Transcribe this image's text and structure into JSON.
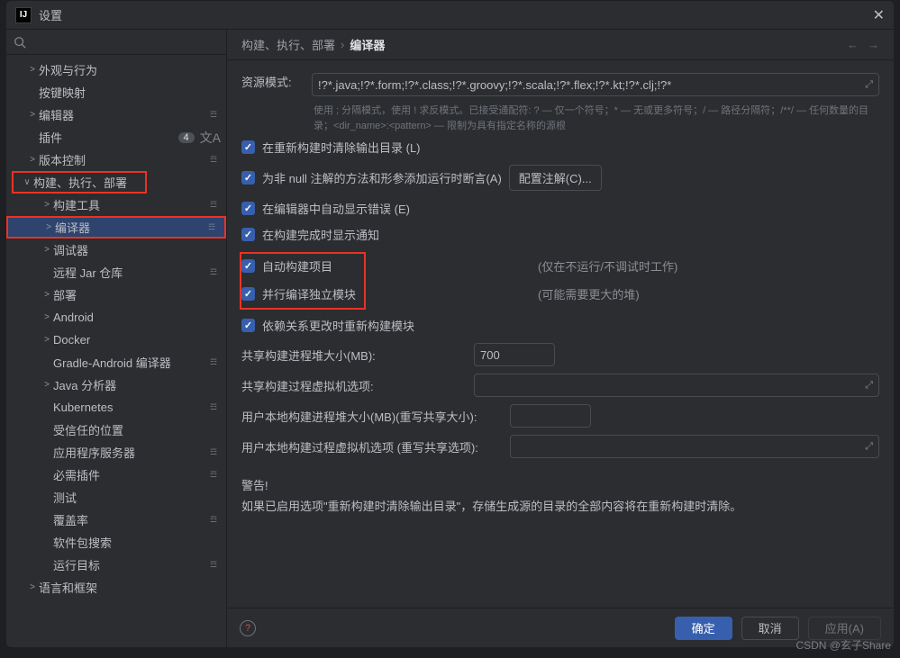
{
  "title": "设置",
  "search": {
    "placeholder": ""
  },
  "sidebar": {
    "items": [
      {
        "label": "外观与行为",
        "chev": ">",
        "d": 0
      },
      {
        "label": "按键映射",
        "chev": "",
        "d": 0
      },
      {
        "label": "编辑器",
        "chev": ">",
        "d": 0,
        "tag": "☲"
      },
      {
        "label": "插件",
        "chev": "",
        "d": 0,
        "badge": "4",
        "lang": "文A"
      },
      {
        "label": "版本控制",
        "chev": ">",
        "d": 0,
        "tag": "☲"
      },
      {
        "label": "构建、执行、部署",
        "chev": "∨",
        "d": 0,
        "hl": true
      },
      {
        "label": "构建工具",
        "chev": ">",
        "d": 1,
        "tag": "☲"
      },
      {
        "label": "编译器",
        "chev": ">",
        "d": 1,
        "tag": "☲",
        "sel": true,
        "hl": true,
        "hlfull": true
      },
      {
        "label": "调试器",
        "chev": ">",
        "d": 1
      },
      {
        "label": "远程 Jar 仓库",
        "chev": "",
        "d": 1,
        "tag": "☲"
      },
      {
        "label": "部署",
        "chev": ">",
        "d": 1
      },
      {
        "label": "Android",
        "chev": ">",
        "d": 1
      },
      {
        "label": "Docker",
        "chev": ">",
        "d": 1
      },
      {
        "label": "Gradle-Android 编译器",
        "chev": "",
        "d": 1,
        "tag": "☲"
      },
      {
        "label": "Java 分析器",
        "chev": ">",
        "d": 1
      },
      {
        "label": "Kubernetes",
        "chev": "",
        "d": 1,
        "tag": "☲"
      },
      {
        "label": "受信任的位置",
        "chev": "",
        "d": 1
      },
      {
        "label": "应用程序服务器",
        "chev": "",
        "d": 1,
        "tag": "☲"
      },
      {
        "label": "必需插件",
        "chev": "",
        "d": 1,
        "tag": "☲"
      },
      {
        "label": "测试",
        "chev": "",
        "d": 1
      },
      {
        "label": "覆盖率",
        "chev": "",
        "d": 1,
        "tag": "☲"
      },
      {
        "label": "软件包搜索",
        "chev": "",
        "d": 1
      },
      {
        "label": "运行目标",
        "chev": "",
        "d": 1,
        "tag": "☲"
      },
      {
        "label": "语言和框架",
        "chev": ">",
        "d": 0
      }
    ]
  },
  "breadcrumb": {
    "parent": "构建、执行、部署",
    "current": "编译器"
  },
  "form": {
    "resource_pattern_label": "资源模式:",
    "resource_pattern_value": "!?*.java;!?*.form;!?*.class;!?*.groovy;!?*.scala;!?*.flex;!?*.kt;!?*.clj;!?*",
    "hint1": "使用 ; 分隔模式，使用 ! 求反模式。已接受通配符: ? — 仅一个符号；* — 无或更多符号；/ — 路径分隔符；/**/ — 任何数量的目录；<dir_name>:<pattern> — 限制为具有指定名称的源根",
    "chk_clear": "在重新构建时清除输出目录 (L)",
    "chk_null": "为非 null 注解的方法和形参添加运行时断言(A)",
    "btn_config": "配置注解(C)...",
    "chk_errors": "在编辑器中自动显示错误 (E)",
    "chk_notify": "在构建完成时显示通知",
    "chk_auto": "自动构建项目",
    "note_auto": "(仅在不运行/不调试时工作)",
    "chk_parallel": "并行编译独立模块",
    "note_parallel": "(可能需要更大的堆)",
    "chk_deps": "依赖关系更改时重新构建模块",
    "heap_label": "共享构建进程堆大小(MB):",
    "heap_value": "700",
    "vm_label": "共享构建过程虚拟机选项:",
    "local_heap_label": "用户本地构建进程堆大小(MB)(重写共享大小):",
    "local_vm_label": "用户本地构建过程虚拟机选项 (重写共享选项):",
    "warn_title": "警告!",
    "warn_body": "如果已启用选项\"重新构建时清除输出目录\"，存储生成源的目录的全部内容将在重新构建时清除。"
  },
  "footer": {
    "ok": "确定",
    "cancel": "取消",
    "apply": "应用(A)"
  },
  "watermark": "CSDN @玄子Share"
}
